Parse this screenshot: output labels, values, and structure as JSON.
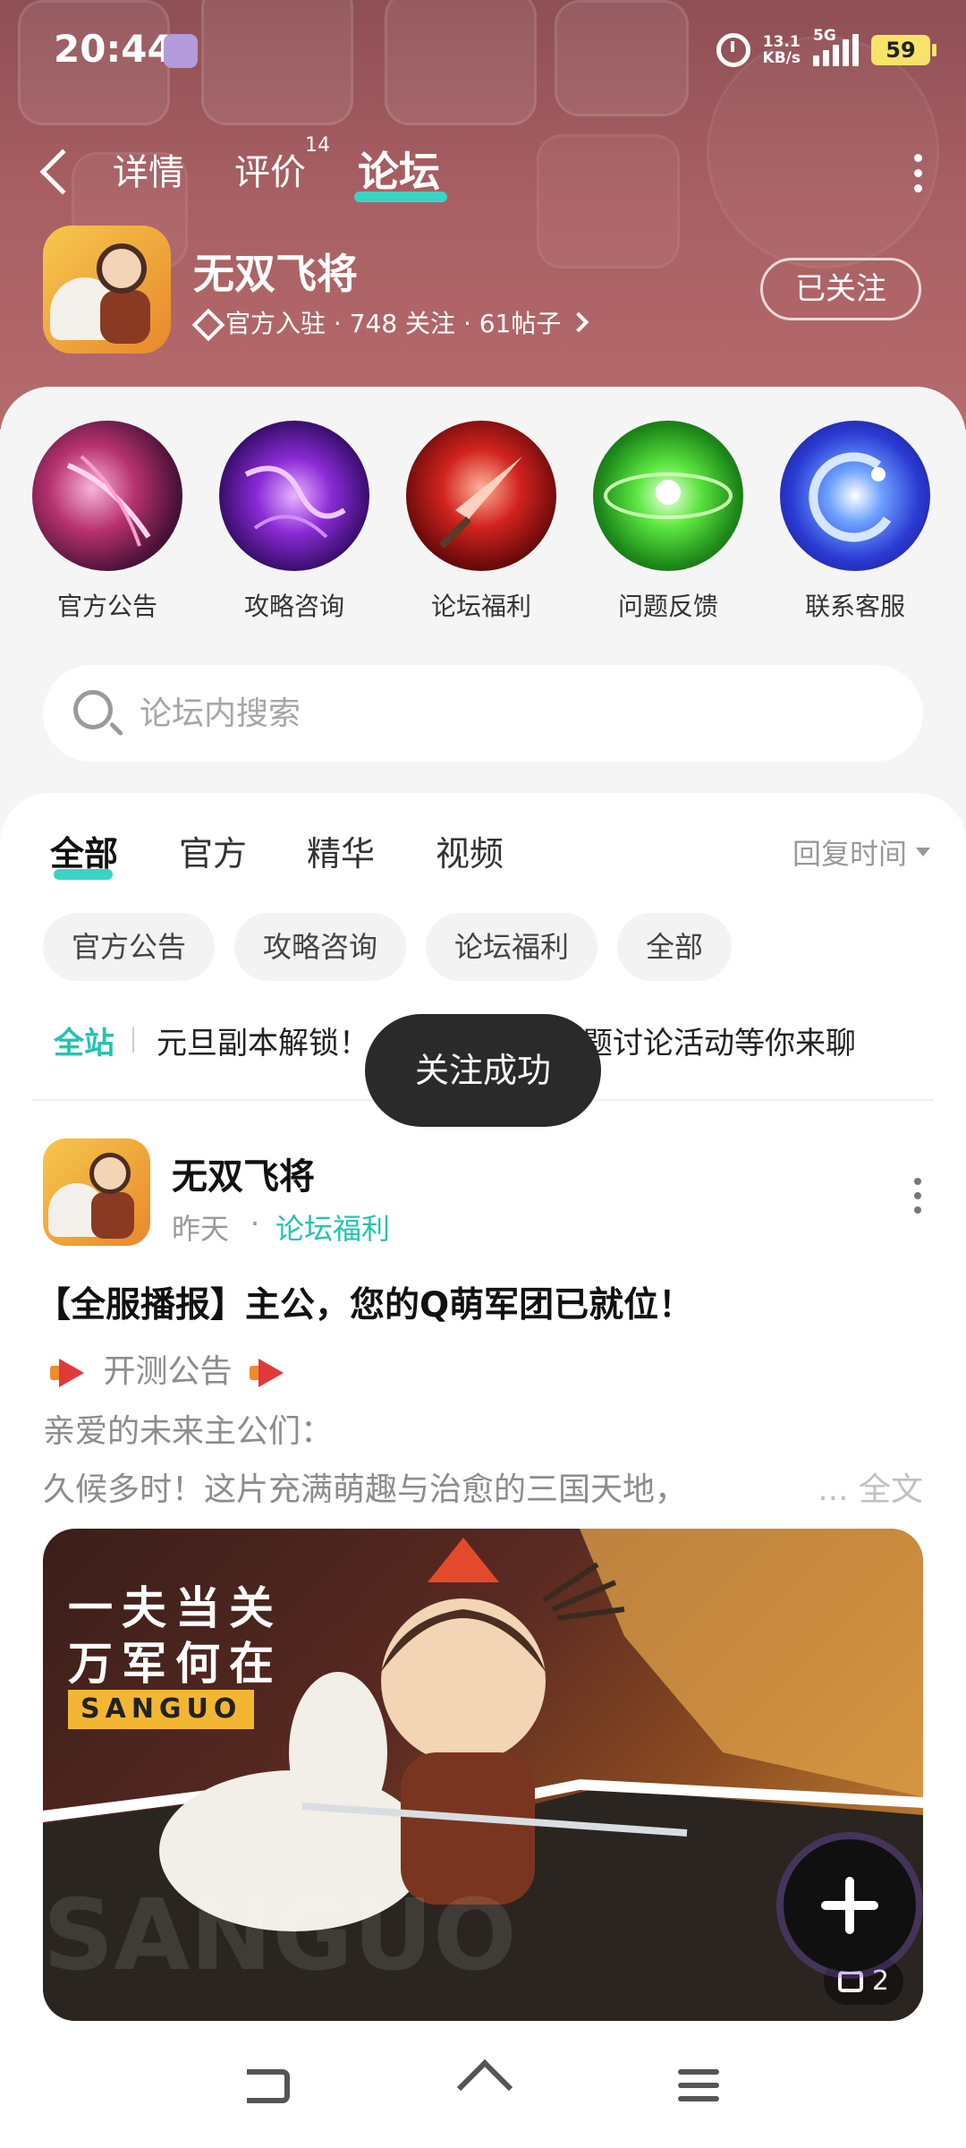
{
  "status_bar": {
    "time": "20:44",
    "net_speed_value": "13.1",
    "net_speed_unit": "KB/s",
    "network": "5G",
    "battery": "59"
  },
  "top_nav": {
    "tabs": [
      {
        "label": "详情"
      },
      {
        "label": "评价",
        "badge": "14"
      },
      {
        "label": "论坛"
      }
    ],
    "active_tab": "论坛"
  },
  "game": {
    "name": "无双飞将",
    "meta": "官方入驻 · 748 关注 · 61帖子",
    "follow_label": "已关注"
  },
  "quick_entries": [
    {
      "label": "官方公告",
      "icon": "announcement-icon"
    },
    {
      "label": "攻略咨询",
      "icon": "strategy-icon"
    },
    {
      "label": "论坛福利",
      "icon": "benefit-icon"
    },
    {
      "label": "问题反馈",
      "icon": "feedback-icon"
    },
    {
      "label": "联系客服",
      "icon": "customer-service-icon"
    }
  ],
  "search": {
    "placeholder": "论坛内搜索"
  },
  "filter_tabs": [
    {
      "label": "全部"
    },
    {
      "label": "官方"
    },
    {
      "label": "精华"
    },
    {
      "label": "视频"
    }
  ],
  "active_filter": "全部",
  "sort_label": "回复时间",
  "chips": [
    {
      "label": "官方公告"
    },
    {
      "label": "攻略咨询"
    },
    {
      "label": "论坛福利"
    },
    {
      "label": "全部"
    }
  ],
  "ticker": {
    "tag": "全站",
    "text_left": "元旦副本解锁！",
    "text_right": "题讨论活动等你来聊"
  },
  "toast": "关注成功",
  "post": {
    "author": "无双飞将",
    "time": "昨天",
    "category": "论坛福利",
    "title": "【全服播报】主公，您的Q萌军团已就位！",
    "line1": "开测公告",
    "line2": "亲爱的未来主公们：",
    "line3": "久候多时！这片充满萌趣与治愈的三国天地，",
    "read_more": "... 全文",
    "image": {
      "slogan_line1": "一夫当关",
      "slogan_line2": "万军何在",
      "tag": "SANGUO",
      "watermark": "SANGUO",
      "image_count": "2"
    }
  }
}
